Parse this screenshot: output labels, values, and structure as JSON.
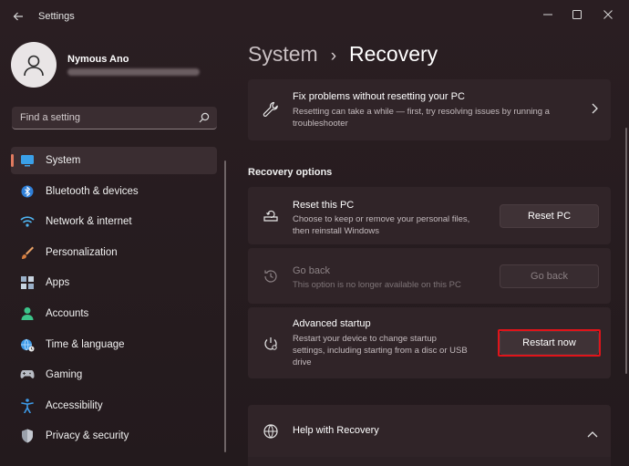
{
  "window": {
    "title": "Settings"
  },
  "user": {
    "name": "Nymous Ano",
    "email": ""
  },
  "search": {
    "placeholder": "Find a setting"
  },
  "sidebar": {
    "items": [
      {
        "label": "System",
        "icon": "monitor-icon",
        "active": true
      },
      {
        "label": "Bluetooth & devices",
        "icon": "bluetooth-icon"
      },
      {
        "label": "Network & internet",
        "icon": "wifi-icon"
      },
      {
        "label": "Personalization",
        "icon": "brush-icon"
      },
      {
        "label": "Apps",
        "icon": "apps-icon"
      },
      {
        "label": "Accounts",
        "icon": "person-icon"
      },
      {
        "label": "Time & language",
        "icon": "globe-clock-icon"
      },
      {
        "label": "Gaming",
        "icon": "gamepad-icon"
      },
      {
        "label": "Accessibility",
        "icon": "accessibility-icon"
      },
      {
        "label": "Privacy & security",
        "icon": "shield-icon"
      }
    ]
  },
  "breadcrumb": {
    "parent": "System",
    "separator": "›",
    "current": "Recovery"
  },
  "fix": {
    "title": "Fix problems without resetting your PC",
    "desc_line1": "Resetting can take a while — first, try resolving issues by running a",
    "desc_line2": "troubleshooter"
  },
  "section": {
    "title": "Recovery options"
  },
  "reset": {
    "title": "Reset this PC",
    "desc_line1": "Choose to keep or remove your personal files,",
    "desc_line2": "then reinstall Windows",
    "button": "Reset PC"
  },
  "goback": {
    "title": "Go back",
    "desc": "This option is no longer available on this PC",
    "button": "Go back"
  },
  "advanced": {
    "title": "Advanced startup",
    "desc_line1": "Restart your device to change startup",
    "desc_line2": "settings, including starting from a disc or USB",
    "desc_line3": "drive",
    "button": "Restart now"
  },
  "help": {
    "title": "Help with Recovery"
  },
  "colors": {
    "accent": "#e07a5f",
    "highlight": "#e0141a"
  }
}
